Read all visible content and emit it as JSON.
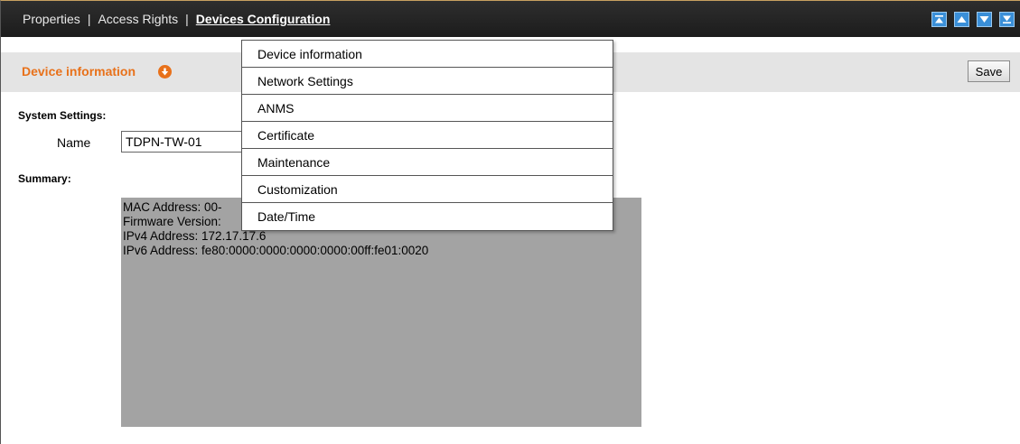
{
  "tabs": [
    {
      "label": "Properties",
      "active": false
    },
    {
      "label": "Access Rights",
      "active": false
    },
    {
      "label": "Devices Configuration",
      "active": true
    }
  ],
  "tab_separator": "|",
  "nav_icons": [
    "move-top-icon",
    "move-up-icon",
    "move-down-icon",
    "move-bottom-icon"
  ],
  "section": {
    "title": "Device information",
    "save_label": "Save"
  },
  "system_settings": {
    "heading": "System Settings:",
    "name_label": "Name",
    "name_value": "TDPN-TW-01"
  },
  "summary": {
    "heading": "Summary:",
    "lines": [
      "MAC Address: 00-",
      "Firmware Version:",
      "IPv4 Address: 172.17.17.6",
      "IPv6 Address: fe80:0000:0000:0000:0000:00ff:fe01:0020"
    ]
  },
  "menu": {
    "items": [
      "Device information",
      "Network Settings",
      "ANMS",
      "Certificate",
      "Maintenance",
      "Customization",
      "Date/Time"
    ]
  },
  "colors": {
    "accent": "#e8711a",
    "topbar": "#262626",
    "nav_button": "#3a8fd8",
    "summary_bg": "#a3a3a3"
  }
}
